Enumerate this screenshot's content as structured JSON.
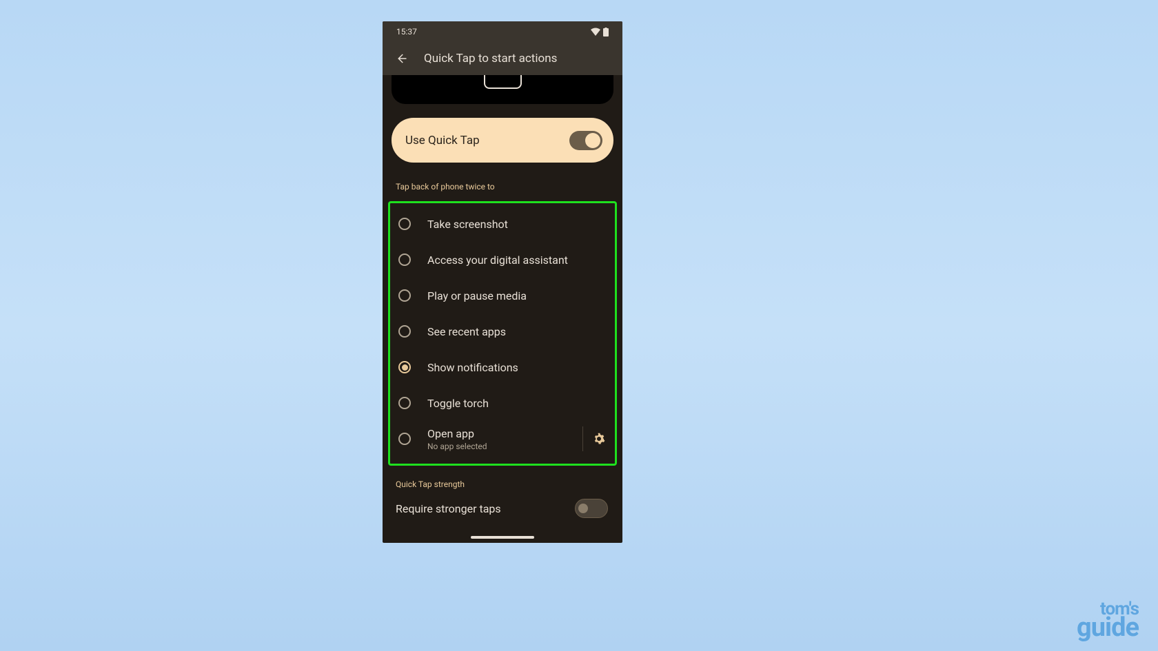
{
  "status": {
    "time": "15:37"
  },
  "header": {
    "title": "Quick Tap to start actions"
  },
  "toggle_card": {
    "label": "Use Quick Tap",
    "enabled": true
  },
  "section1": {
    "label": "Tap back of phone twice to"
  },
  "options": [
    {
      "label": "Take screenshot",
      "selected": false
    },
    {
      "label": "Access your digital assistant",
      "selected": false
    },
    {
      "label": "Play or pause media",
      "selected": false
    },
    {
      "label": "See recent apps",
      "selected": false
    },
    {
      "label": "Show notifications",
      "selected": true
    },
    {
      "label": "Toggle torch",
      "selected": false
    },
    {
      "label": "Open app",
      "sub": "No app selected",
      "selected": false,
      "has_gear": true
    }
  ],
  "section2": {
    "label": "Quick Tap strength"
  },
  "setting": {
    "label": "Require stronger taps",
    "enabled": false
  },
  "watermark": {
    "line1": "tom's",
    "line2": "guide"
  }
}
